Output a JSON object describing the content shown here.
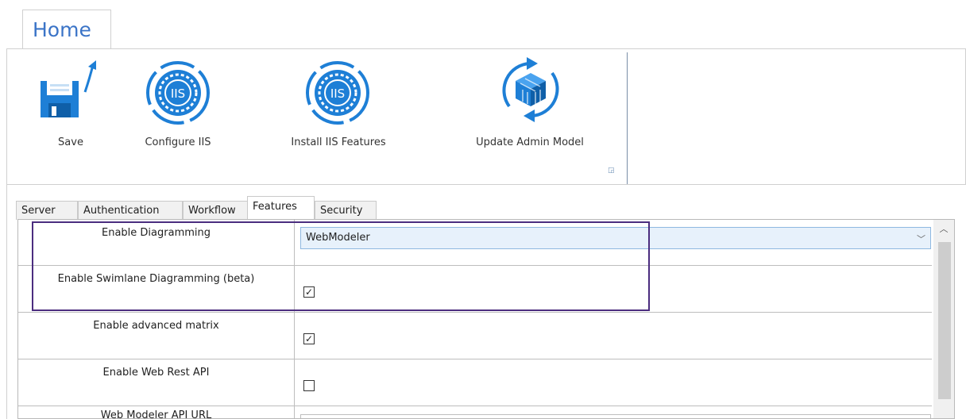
{
  "ribbon": {
    "tab_label": "Home",
    "buttons": [
      {
        "label": "Save",
        "icon": "save-icon"
      },
      {
        "label": "Configure IIS",
        "icon": "iis-gear-icon"
      },
      {
        "label": "Install IIS Features",
        "icon": "iis-gear-icon"
      },
      {
        "label": "Update Admin Model",
        "icon": "cube-refresh-icon"
      }
    ],
    "iis_text": "IIS"
  },
  "tabs": [
    "Server",
    "Authentication",
    "Workflow",
    "Features",
    "Security"
  ],
  "active_tab": "Features",
  "rows": [
    {
      "label": "Enable Diagramming",
      "type": "combo",
      "value": "WebModeler"
    },
    {
      "label": "Enable Swimlane Diagramming (beta)",
      "type": "checkbox",
      "checked": true
    },
    {
      "label": "Enable advanced matrix",
      "type": "checkbox",
      "checked": true
    },
    {
      "label": "Enable Web Rest API",
      "type": "checkbox",
      "checked": false
    },
    {
      "label": "Web Modeler API URL",
      "type": "text",
      "value": ""
    }
  ],
  "colors": {
    "accent": "#3b74c7",
    "highlight": "#4b2d7f",
    "iis_blue": "#1e7fd6"
  }
}
